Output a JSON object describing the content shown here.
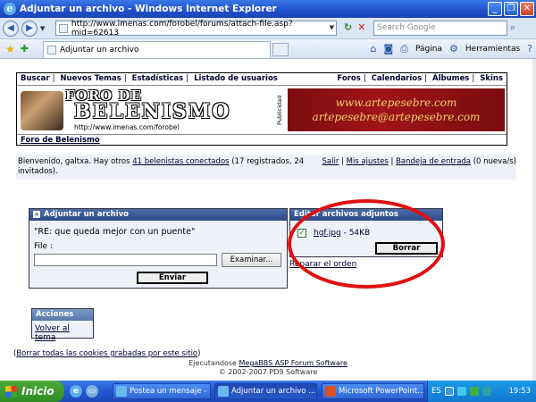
{
  "window": {
    "title": "Adjuntar un archivo - Windows Internet Explorer"
  },
  "addressbar": {
    "url": "http://www.imenas.com/forobel/forums/attach-file.asp?mid=62613",
    "search_placeholder": "Search Google"
  },
  "tabs": [
    {
      "label": "Adjuntar un archivo"
    }
  ],
  "commandbar": {
    "page_label": "Página",
    "tools_label": "Herramientas"
  },
  "forum": {
    "nav_left": [
      "Buscar",
      "Nuevos Temas",
      "Estadísticas",
      "Listado de usuarios"
    ],
    "nav_right": [
      "Foros",
      "Calendarios",
      "Álbumes",
      "Skins"
    ],
    "logo_line1": "FORO DE",
    "logo_line2": "BELENISMO",
    "logo_url": "http://www.imenas.com/forobel",
    "publicidad": "Publicidad",
    "ad_line1": "www.artepesebre.com",
    "ad_line2": "artepesebre@artepesebre.com",
    "breadcrumb": "Foro de Belenismo"
  },
  "welcome": {
    "prefix": "Bienvenido, galtxa. Hay otros ",
    "link": "41 belenistas conectados",
    "suffix": " (17 registrados, 24 invitados).",
    "salir": "Salir",
    "ajustes": "Mis ajustes",
    "bandeja": "Bandeja de entrada",
    "bandeja_count": "(0 nueva/s)"
  },
  "upload_panel": {
    "title": "Adjuntar un archivo",
    "subject": "\"RE: que queda mejor con un puente\"",
    "file_label": "File :",
    "browse_label": "Examinar...",
    "send_label": "Enviar"
  },
  "edit_panel": {
    "title": "Editar archivos adjuntos",
    "file_name": "hgf.jpg",
    "file_size": " - 54KB",
    "delete_label": "Borrar",
    "repair_label": "Reparar el orden"
  },
  "actions_panel": {
    "title": "Acciones",
    "back_label": "Volver al tema"
  },
  "footer": {
    "cookies": "Borrar todas las cookies grabadas por este sitio",
    "running_prefix": "Ejecutandose ",
    "running_link": "MegaBBS ASP Forum Software",
    "copyright": "© 2002-2007 PD9 Software"
  },
  "taskbar": {
    "start_label": "Inicio",
    "tasks": [
      "Postea un mensaje - ...",
      "Adjuntar un archivo ...",
      "Microsoft PowerPoint..."
    ],
    "lang": "ES",
    "clock": "19:53"
  },
  "colors": {
    "annotation_circle": "#e01010",
    "panel_header": "#2a4a88"
  }
}
